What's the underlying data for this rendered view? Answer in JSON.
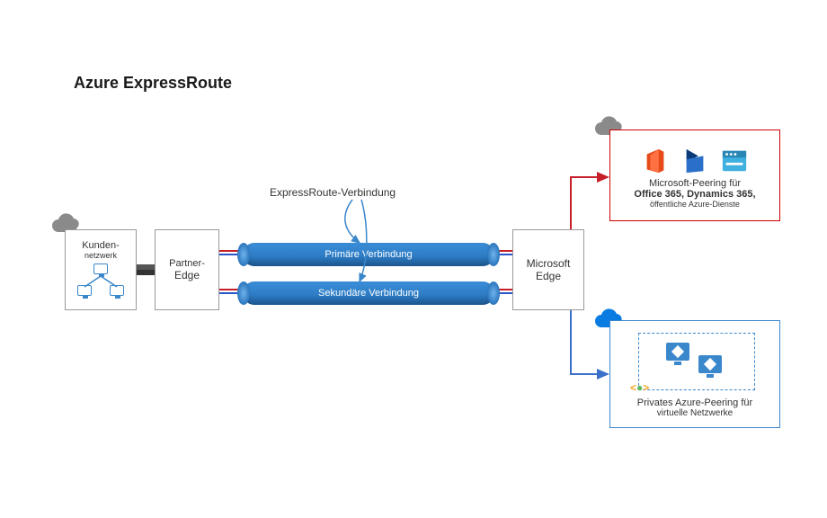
{
  "title": "Azure ExpressRoute",
  "customer": {
    "label_top": "Kunden-",
    "label_bottom": "netzwerk"
  },
  "partner": {
    "label_top": "Partner-",
    "label_bottom": "Edge"
  },
  "expressroute_caption": "ExpressRoute-Verbindung",
  "pipes": {
    "primary": "Primäre Verbindung",
    "secondary": "Sekundäre Verbindung"
  },
  "ms_edge": {
    "line1": "Microsoft",
    "line2": "Edge"
  },
  "ms_peering": {
    "line1": "Microsoft-Peering für",
    "line2": "Office 365, Dynamics 365,",
    "line3": "öffentliche Azure-Dienste"
  },
  "private_peering": {
    "line1": "Privates Azure-Peering für",
    "line2": "virtuelle Netzwerke"
  },
  "icons": {
    "cloud": "cloud-icon",
    "office": "office-icon",
    "dynamics": "dynamics-icon",
    "web": "web-icon"
  }
}
